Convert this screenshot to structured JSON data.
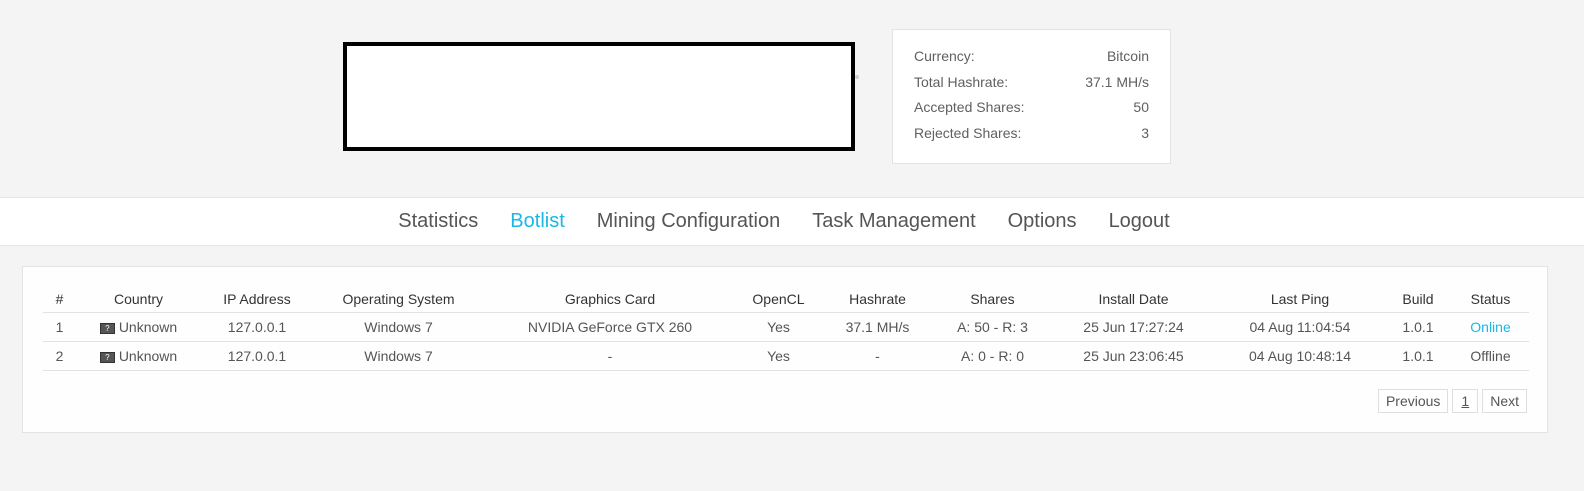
{
  "stats": [
    {
      "label": "Currency:",
      "value": "Bitcoin"
    },
    {
      "label": "Total Hashrate:",
      "value": "37.1 MH/s"
    },
    {
      "label": "Accepted Shares:",
      "value": "50"
    },
    {
      "label": "Rejected Shares:",
      "value": "3"
    }
  ],
  "nav": {
    "items": [
      "Statistics",
      "Botlist",
      "Mining Configuration",
      "Task Management",
      "Options",
      "Logout"
    ],
    "active": "Botlist"
  },
  "table": {
    "headers": [
      "#",
      "Country",
      "IP Address",
      "Operating System",
      "Graphics Card",
      "OpenCL",
      "Hashrate",
      "Shares",
      "Install Date",
      "Last Ping",
      "Build",
      "Status"
    ],
    "rows": [
      {
        "num": "1",
        "country": "Unknown",
        "ip": "127.0.0.1",
        "os": "Windows 7",
        "gpu": "NVIDIA GeForce GTX 260",
        "opencl": "Yes",
        "hashrate": "37.1 MH/s",
        "shares": "A: 50 - R: 3",
        "install_date": "25 Jun 17:27:24",
        "last_ping": "04 Aug 11:04:54",
        "build": "1.0.1",
        "status": "Online"
      },
      {
        "num": "2",
        "country": "Unknown",
        "ip": "127.0.0.1",
        "os": "Windows 7",
        "gpu": "-",
        "opencl": "Yes",
        "hashrate": "-",
        "shares": "A: 0 - R: 0",
        "install_date": "25 Jun 23:06:45",
        "last_ping": "04 Aug 10:48:14",
        "build": "1.0.1",
        "status": "Offline"
      }
    ]
  },
  "pagination": {
    "previous": "Previous",
    "page": "1",
    "next": "Next"
  },
  "colors": {
    "accent": "#1ab8e6"
  },
  "icons": {
    "flag": "unknown-flag-icon"
  }
}
